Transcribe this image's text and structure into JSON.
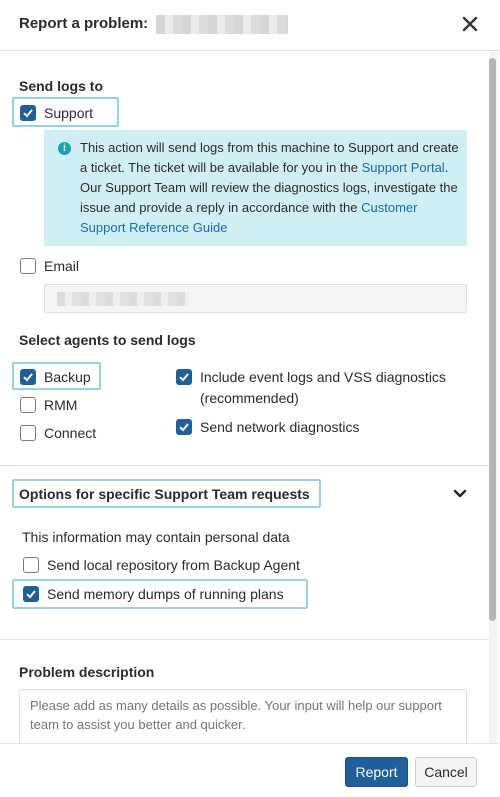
{
  "header": {
    "title": "Report a problem:",
    "close_icon": "close-icon"
  },
  "send_logs": {
    "title": "Send logs to",
    "support": {
      "label": "Support",
      "checked": true
    },
    "info": {
      "icon": "info-icon",
      "text_1": "This action will send logs from this machine to Support and create a ticket. The ticket will be available for you in the ",
      "link_1": "Support Portal",
      "text_2": ". Our Support Team will review the diagnostics logs, investigate the issue and provide a reply in accordance with the ",
      "link_2": "Customer Support Reference Guide"
    },
    "email": {
      "label": "Email",
      "checked": false
    }
  },
  "agents": {
    "title": "Select agents to send logs",
    "backup": {
      "label": "Backup",
      "checked": true
    },
    "rmm": {
      "label": "RMM",
      "checked": false
    },
    "connect": {
      "label": "Connect",
      "checked": false
    },
    "event_logs": {
      "label_line1": "Include event logs and VSS diagnostics",
      "label_line2": "(recommended)",
      "checked": true
    },
    "network": {
      "label": "Send network diagnostics",
      "checked": true
    }
  },
  "options": {
    "title": "Options for specific Support Team requests",
    "note": "This information may contain personal data",
    "local_repo": {
      "label": "Send local repository from Backup Agent",
      "checked": false
    },
    "memory_dumps": {
      "label": "Send memory dumps of running plans",
      "checked": true
    }
  },
  "problem": {
    "title": "Problem description",
    "placeholder": "Please add as many details as possible. Your input will help our support team to assist you better and quicker."
  },
  "footer": {
    "report_label": "Report",
    "cancel_label": "Cancel"
  },
  "colors": {
    "primary": "#1f5f9c",
    "highlight": "#8fd6e6",
    "info_bg": "#d0eff5",
    "link": "#1b6aa8"
  }
}
